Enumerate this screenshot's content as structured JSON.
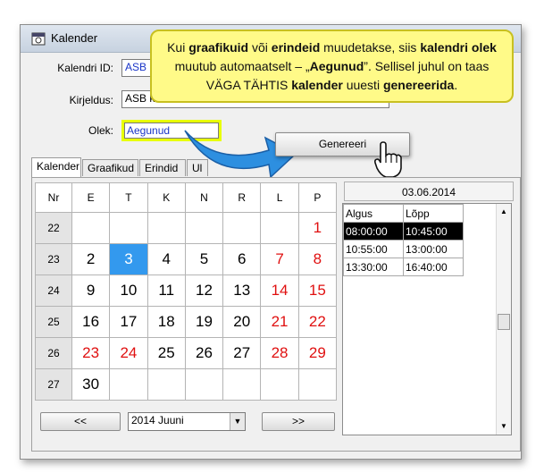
{
  "window": {
    "title": "Kalender"
  },
  "form": {
    "calendar_id_label": "Kalendri ID:",
    "calendar_id_value": "ASB",
    "description_label": "Kirjeldus:",
    "description_value": "ASB ka",
    "status_label": "Olek:",
    "status_value": "Aegunud",
    "generate_button": "Genereeri"
  },
  "tabs": [
    "Kalender",
    "Graafikud",
    "Erindid",
    "Ul"
  ],
  "calendar": {
    "week_header": "Nr",
    "day_headers": [
      "E",
      "T",
      "K",
      "N",
      "R",
      "L",
      "P"
    ],
    "rows": [
      {
        "week": "22",
        "days": [
          "",
          "",
          "",
          "",
          "",
          "",
          "1"
        ]
      },
      {
        "week": "23",
        "days": [
          "2",
          "3",
          "4",
          "5",
          "6",
          "7",
          "8"
        ]
      },
      {
        "week": "24",
        "days": [
          "9",
          "10",
          "11",
          "12",
          "13",
          "14",
          "15"
        ]
      },
      {
        "week": "25",
        "days": [
          "16",
          "17",
          "18",
          "19",
          "20",
          "21",
          "22"
        ]
      },
      {
        "week": "26",
        "days": [
          "23",
          "24",
          "25",
          "26",
          "27",
          "28",
          "29"
        ]
      },
      {
        "week": "27",
        "days": [
          "30",
          "",
          "",
          "",
          "",
          "",
          ""
        ]
      }
    ],
    "selected_day": "3",
    "red_days": [
      "1",
      "7",
      "8",
      "14",
      "15",
      "21",
      "22",
      "23",
      "24",
      "28",
      "29"
    ],
    "prev_button": "<<",
    "next_button": ">>",
    "month_select": "2014 Juuni"
  },
  "schedule": {
    "date": "03.06.2014",
    "headers": [
      "Algus",
      "Lõpp"
    ],
    "rows": [
      {
        "start": "08:00:00",
        "end": "10:45:00"
      },
      {
        "start": "10:55:00",
        "end": "13:00:00"
      },
      {
        "start": "13:30:00",
        "end": "16:40:00"
      }
    ]
  },
  "callout": {
    "p1": "Kui ",
    "b1": "graafikuid",
    "p2": " või ",
    "b2": "erindeid",
    "p3": " muudetakse, siis ",
    "b3": "kalendri olek",
    "p4": " muutub automaatselt – „",
    "b4": "Aegunud",
    "p5": "”.  Sellisel juhul on taas VÄGA TÄHTIS ",
    "b5": "kalender",
    "p6": " uuesti ",
    "b6": "genereerida",
    "p7": "."
  },
  "colors": {
    "callout_bg": "#fffa88",
    "highlight_border": "#e8ff00",
    "selected_day": "#3399ee",
    "holiday_red": "#e01010",
    "arrow_blue": "#2d8fe0"
  }
}
